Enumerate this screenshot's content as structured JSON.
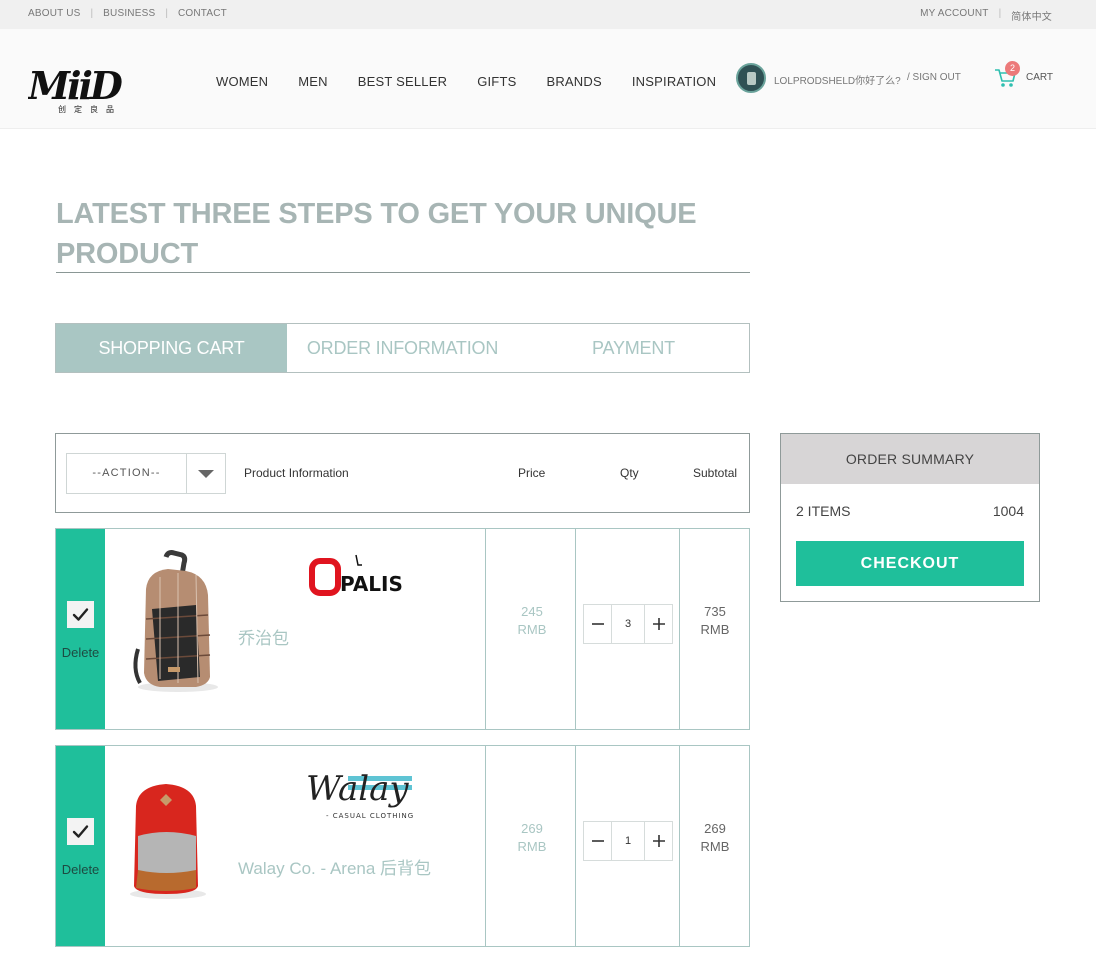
{
  "top_bar": {
    "left_links": [
      "ABOUT US",
      "BUSINESS",
      "CONTACT"
    ],
    "my_account": "MY ACCOUNT",
    "language": "简体中文"
  },
  "brand": {
    "logo_text": "MiiD",
    "logo_subtitle": "创定良品"
  },
  "nav": {
    "items": [
      "WOMEN",
      "MEN",
      "BEST SELLER",
      "GIFTS",
      "BRANDS",
      "INSPIRATION"
    ]
  },
  "user": {
    "name": "LOLPRODSHELD你好了么?",
    "sign_out": "/ SIGN OUT"
  },
  "cart": {
    "count": "2",
    "label": "CART"
  },
  "steps": {
    "title": "LATEST THREE STEPS TO GET YOUR UNIQUE PRODUCT",
    "tabs": [
      "SHOPPING CART",
      "ORDER INFORMATION",
      "PAYMENT"
    ],
    "active_tab": 0
  },
  "cart_table": {
    "action_placeholder": "--ACTION--",
    "columns": {
      "product": "Product Information",
      "price": "Price",
      "qty": "Qty",
      "subtotal": "Subtotal"
    }
  },
  "items": [
    {
      "brand": "OPALIS",
      "name": "乔治包",
      "price": "245",
      "price_unit": "RMB",
      "qty": "3",
      "subtotal": "735",
      "subtotal_unit": "RMB",
      "delete_label": "Delete",
      "checked": true
    },
    {
      "brand": "Walay",
      "brand_tagline": "- CASUAL CLOTHING -",
      "name": "Walay Co. - Arena 后背包",
      "price": "269",
      "price_unit": "RMB",
      "qty": "1",
      "subtotal": "269",
      "subtotal_unit": "RMB",
      "delete_label": "Delete",
      "checked": true
    }
  ],
  "summary": {
    "title": "ORDER SUMMARY",
    "items_label": "2 ITEMS",
    "total": "1004",
    "checkout_label": "CHECKOUT"
  },
  "colors": {
    "accent_green": "#1fbf9b",
    "muted_teal": "#a9c6c3",
    "badge_red": "#ec7a7a",
    "summary_header": "#d7d5d6"
  }
}
